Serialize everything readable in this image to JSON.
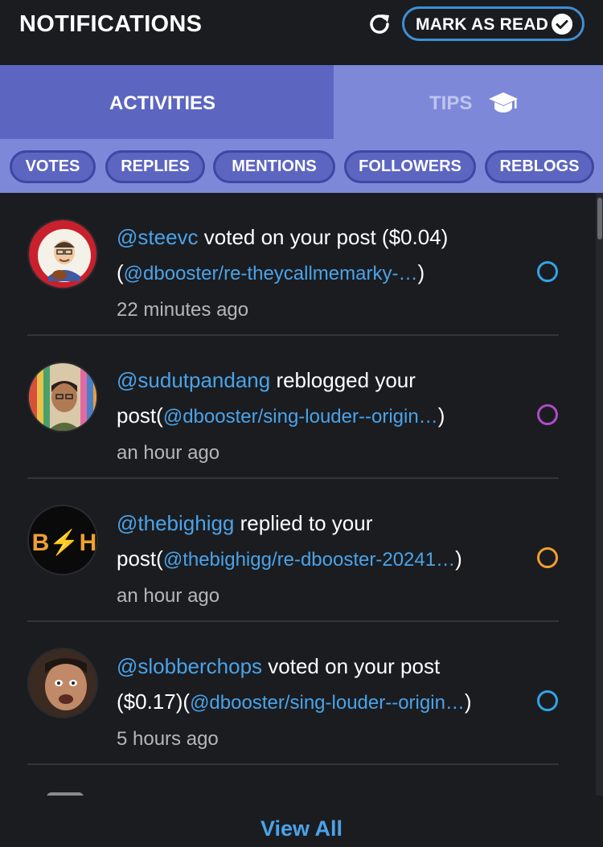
{
  "header": {
    "title": "NOTIFICATIONS",
    "refresh_icon": "refresh-icon",
    "mark_read_label": "MARK AS READ",
    "mark_read_icon": "check-circle-icon"
  },
  "tabs": [
    {
      "label": "ACTIVITIES",
      "active": true
    },
    {
      "label": "TIPS",
      "icon": "graduation-cap-icon",
      "active": false
    }
  ],
  "filters": [
    "VOTES",
    "REPLIES",
    "MENTIONS",
    "FOLLOWERS",
    "REBLOGS"
  ],
  "notifications": [
    {
      "user": "@steevc",
      "action": " voted on your post ($0.04)",
      "link_prefix": "(",
      "link": "@dbooster/re-theycallmemarky-…",
      "link_suffix": ")",
      "time": "22 minutes ago",
      "status_color": "#33a4e6"
    },
    {
      "user": "@sudutpandang",
      "action": " reblogged your post",
      "link_prefix": "(",
      "link": "@dbooster/sing-louder--origin…",
      "link_suffix": ")",
      "time": "an hour ago",
      "status_color": "#b04bc8"
    },
    {
      "user": "@thebighigg",
      "action": " replied to your post",
      "link_prefix": "(",
      "link": "@thebighigg/re-dbooster-20241…",
      "link_suffix": ")",
      "time": "an hour ago",
      "status_color": "#f0a030",
      "avatar_text": "B⚡H"
    },
    {
      "user": "@slobberchops",
      "action": " voted on your post ($0.17)",
      "link_prefix": "(",
      "link": "@dbooster/sing-louder--origin…",
      "link_suffix": ")",
      "time": "5 hours ago",
      "status_color": "#33a4e6"
    }
  ],
  "footer": {
    "view_all": "View All"
  }
}
